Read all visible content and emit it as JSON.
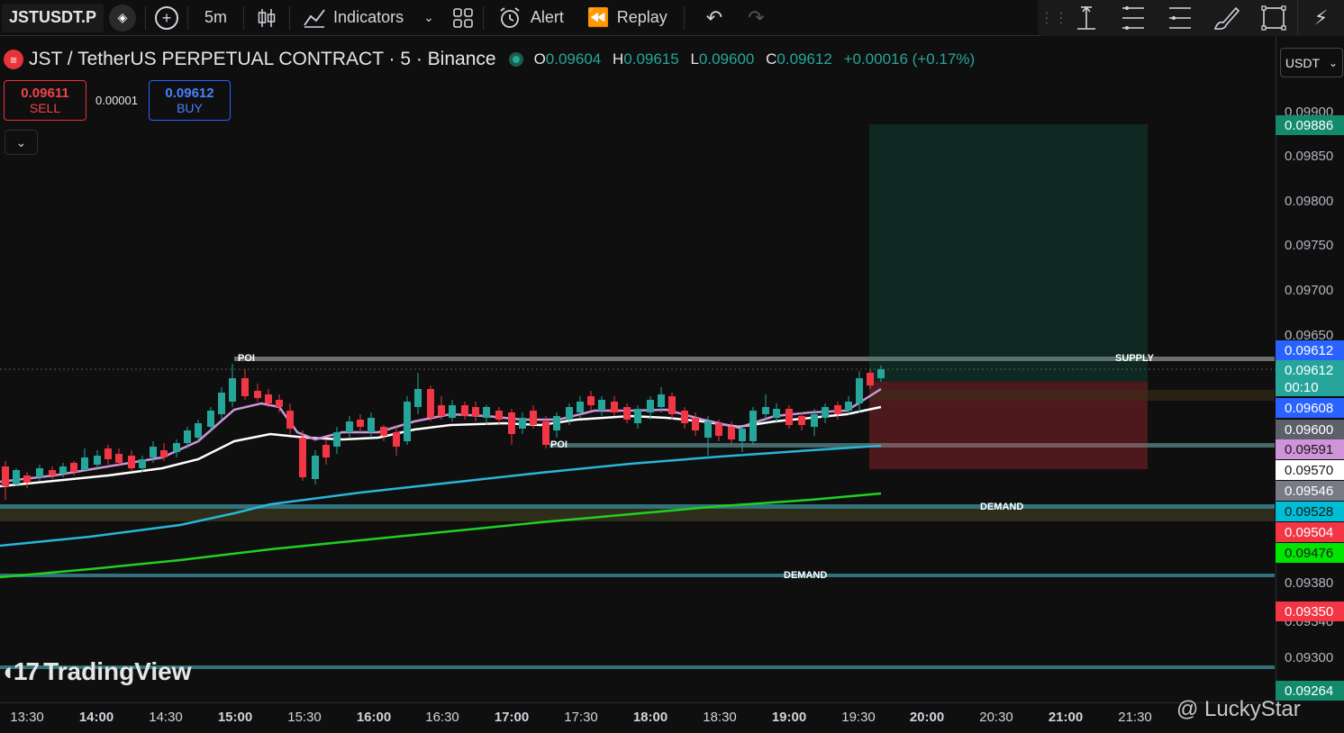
{
  "toolbar": {
    "symbol": "JSTUSDT.P",
    "interval": "5m",
    "indicators": "Indicators",
    "alert": "Alert",
    "replay": "Replay"
  },
  "legend": {
    "title": "JST / TetherUS PERPETUAL CONTRACT · 5 · Binance",
    "o_label": "O",
    "o": "0.09604",
    "h_label": "H",
    "h": "0.09615",
    "l_label": "L",
    "l": "0.09600",
    "c_label": "C",
    "c": "0.09612",
    "change": "+0.00016 (+0.17%)"
  },
  "trade": {
    "sell_price": "0.09611",
    "sell_label": "SELL",
    "spread": "0.00001",
    "buy_price": "0.09612",
    "buy_label": "BUY"
  },
  "currency": "USDT",
  "price_axis": [
    "0.09900",
    "0.09850",
    "0.09800",
    "0.09750",
    "0.09700",
    "0.09650",
    "0.09380",
    "0.09340",
    "0.09300"
  ],
  "price_tags": [
    {
      "text": "0.09886",
      "bg": "#138a6b",
      "fg": "#ffffff"
    },
    {
      "text": "0.09612",
      "bg": "#2962ff",
      "fg": "#ffffff"
    },
    {
      "text": "0.09612",
      "bg": "#26a69a",
      "fg": "#ffffff"
    },
    {
      "text": "00:10",
      "bg": "#26a69a",
      "fg": "#ffffff"
    },
    {
      "text": "0.09608",
      "bg": "#2962ff",
      "fg": "#ffffff"
    },
    {
      "text": "0.09600",
      "bg": "#5d606b",
      "fg": "#ffffff"
    },
    {
      "text": "0.09591",
      "bg": "#ce93d8",
      "fg": "#1a1a1a"
    },
    {
      "text": "0.09570",
      "bg": "#ffffff",
      "fg": "#1a1a1a"
    },
    {
      "text": "0.09546",
      "bg": "#787b86",
      "fg": "#ffffff"
    },
    {
      "text": "0.09528",
      "bg": "#00bcd4",
      "fg": "#1a1a1a"
    },
    {
      "text": "0.09504",
      "bg": "#f23645",
      "fg": "#ffffff"
    },
    {
      "text": "0.09476",
      "bg": "#00e600",
      "fg": "#1a1a1a"
    },
    {
      "text": "0.09350",
      "bg": "#f23645",
      "fg": "#ffffff"
    },
    {
      "text": "0.09264",
      "bg": "#138a6b",
      "fg": "#ffffff"
    }
  ],
  "time_axis": [
    "13:30",
    "14:00",
    "14:30",
    "15:00",
    "15:30",
    "16:00",
    "16:30",
    "17:00",
    "17:30",
    "18:00",
    "18:30",
    "19:00",
    "19:30",
    "20:00",
    "20:30",
    "21:00",
    "21:30"
  ],
  "zones": {
    "supply": "SUPPLY",
    "demand1": "DEMAND",
    "demand2": "DEMAND",
    "poi1": "POI",
    "poi2": "POI"
  },
  "watermark": "TradingView",
  "credit": "@ LuckyStar"
}
